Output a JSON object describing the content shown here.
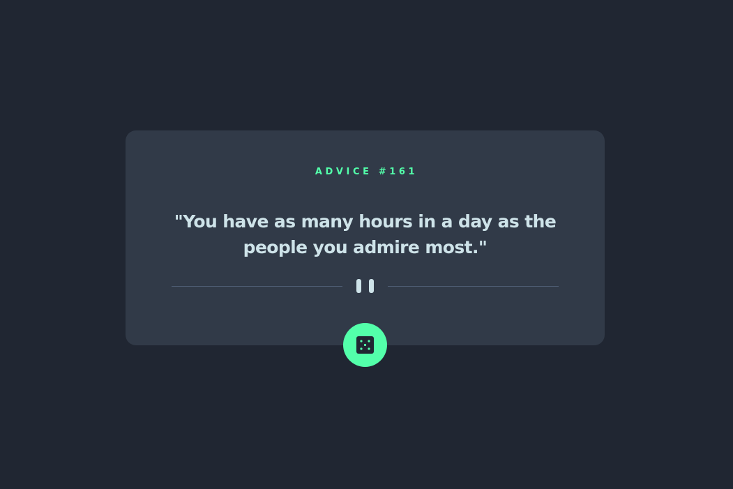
{
  "advice": {
    "id_label": "ADVICE #161",
    "quote": "\"You have as many hours in a day as the people you admire most.\""
  },
  "divider": {
    "icon": "pause-icon"
  },
  "button": {
    "icon": "dice-icon"
  },
  "colors": {
    "background": "#202632",
    "card": "#313a48",
    "accent": "#53ffaa",
    "text": "#cee3e9",
    "divider": "#4f5d74"
  }
}
